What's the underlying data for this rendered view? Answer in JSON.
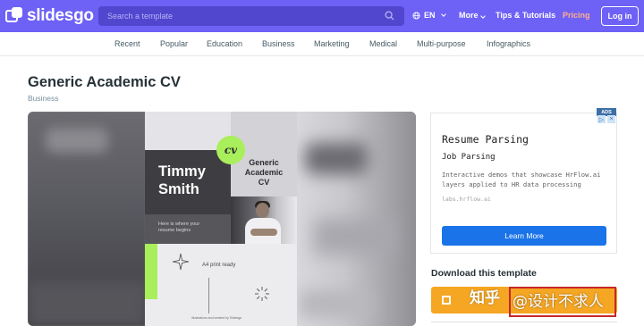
{
  "app": {
    "logo_text": "slidesgo"
  },
  "search": {
    "placeholder": "Search a template"
  },
  "topnav": {
    "language": "EN",
    "more": "More",
    "tips": "Tips & Tutorials",
    "pricing": "Pricing",
    "login": "Log in"
  },
  "categories": [
    "Recent",
    "Popular",
    "Education",
    "Business",
    "Marketing",
    "Medical",
    "Multi-purpose",
    "Infographics"
  ],
  "page": {
    "title": "Generic Academic CV",
    "breadcrumb": "Business"
  },
  "preview": {
    "badge": "cv",
    "name_line1": "Timmy",
    "name_line2": "Smith",
    "title_line1": "Generic",
    "title_line2": "Academic",
    "title_line3": "CV",
    "note_line1": "Here is where your",
    "note_line2": "resume begins",
    "ready": "A4 print ready",
    "credit": "Illustrations and created by Slidesgo"
  },
  "ad": {
    "tag": "ADS",
    "title": "Resume Parsing",
    "subtitle": "Job Parsing",
    "description": "Interactive demos that showcase HrFlow.ai layers applied to HR data processing",
    "url": "labs.hrflow.ai",
    "button": "Learn More"
  },
  "download": {
    "label": "Download this template"
  },
  "watermark": {
    "site": "知乎",
    "author": "@设计不求人"
  },
  "colors": {
    "brand": "#6e61f6",
    "pricing": "#ffb088",
    "accent_green": "#a9ee5b",
    "download": "#f5a623",
    "ad_button": "#1a73e8"
  }
}
